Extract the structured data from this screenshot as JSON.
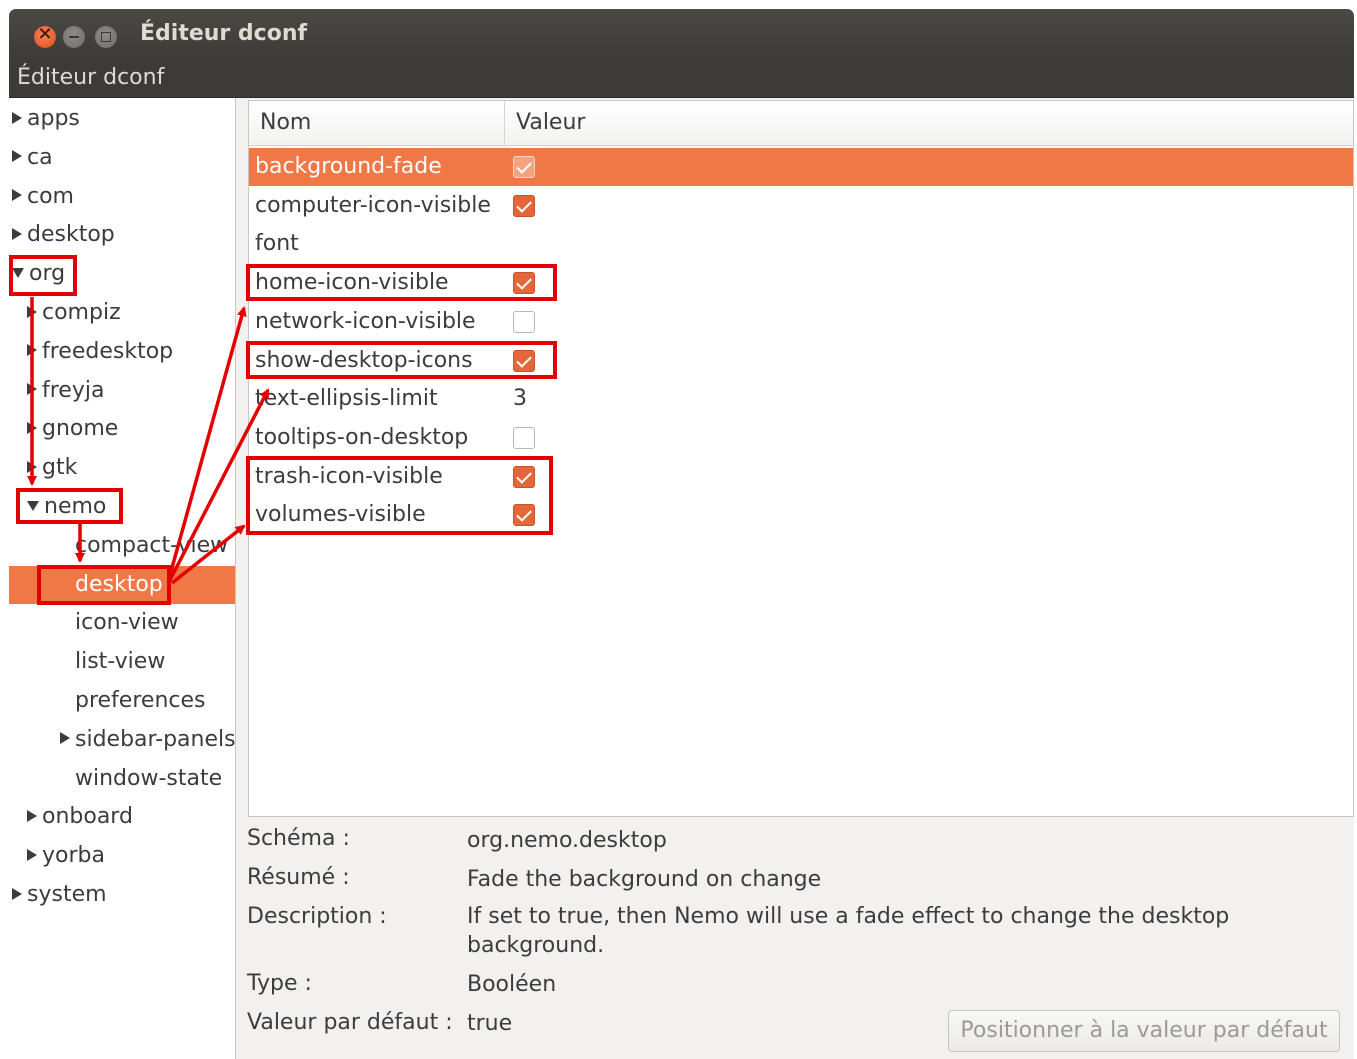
{
  "window": {
    "title": "Éditeur dconf"
  },
  "menubar": {
    "app_menu": "Éditeur dconf"
  },
  "tree": {
    "items": [
      {
        "label": "apps",
        "expander": "collapsed",
        "depth": 0,
        "selected": false
      },
      {
        "label": "ca",
        "expander": "collapsed",
        "depth": 0,
        "selected": false
      },
      {
        "label": "com",
        "expander": "collapsed",
        "depth": 0,
        "selected": false
      },
      {
        "label": "desktop",
        "expander": "collapsed",
        "depth": 0,
        "selected": false
      },
      {
        "label": "org",
        "expander": "expanded",
        "depth": 0,
        "selected": false
      },
      {
        "label": "compiz",
        "expander": "collapsed",
        "depth": 1,
        "selected": false
      },
      {
        "label": "freedesktop",
        "expander": "collapsed",
        "depth": 1,
        "selected": false
      },
      {
        "label": "freyja",
        "expander": "collapsed",
        "depth": 1,
        "selected": false
      },
      {
        "label": "gnome",
        "expander": "collapsed",
        "depth": 1,
        "selected": false
      },
      {
        "label": "gtk",
        "expander": "collapsed",
        "depth": 1,
        "selected": false
      },
      {
        "label": "nemo",
        "expander": "expanded",
        "depth": 1,
        "selected": false
      },
      {
        "label": "compact-view",
        "expander": "none",
        "depth": 2,
        "selected": false
      },
      {
        "label": "desktop",
        "expander": "none",
        "depth": 2,
        "selected": true
      },
      {
        "label": "icon-view",
        "expander": "none",
        "depth": 2,
        "selected": false
      },
      {
        "label": "list-view",
        "expander": "none",
        "depth": 2,
        "selected": false
      },
      {
        "label": "preferences",
        "expander": "none",
        "depth": 2,
        "selected": false
      },
      {
        "label": "sidebar-panels",
        "expander": "collapsed",
        "depth": 2,
        "selected": false
      },
      {
        "label": "window-state",
        "expander": "none",
        "depth": 2,
        "selected": false
      },
      {
        "label": "onboard",
        "expander": "collapsed",
        "depth": 1,
        "selected": false
      },
      {
        "label": "yorba",
        "expander": "collapsed",
        "depth": 1,
        "selected": false
      },
      {
        "label": "system",
        "expander": "collapsed",
        "depth": 0,
        "selected": false
      }
    ]
  },
  "keys": {
    "columns": [
      "Nom",
      "Valeur"
    ],
    "rows": [
      {
        "name": "background-fade",
        "type": "bool",
        "value": true,
        "selected": true
      },
      {
        "name": "computer-icon-visible",
        "type": "bool",
        "value": true,
        "selected": false
      },
      {
        "name": "font",
        "type": "text",
        "value": "",
        "selected": false
      },
      {
        "name": "home-icon-visible",
        "type": "bool",
        "value": true,
        "selected": false
      },
      {
        "name": "network-icon-visible",
        "type": "bool",
        "value": false,
        "selected": false
      },
      {
        "name": "show-desktop-icons",
        "type": "bool",
        "value": true,
        "selected": false
      },
      {
        "name": "text-ellipsis-limit",
        "type": "text",
        "value": "3",
        "selected": false
      },
      {
        "name": "tooltips-on-desktop",
        "type": "bool",
        "value": false,
        "selected": false
      },
      {
        "name": "trash-icon-visible",
        "type": "bool",
        "value": true,
        "selected": false
      },
      {
        "name": "volumes-visible",
        "type": "bool",
        "value": true,
        "selected": false
      }
    ]
  },
  "details": {
    "schema_label": "Schéma :",
    "schema_value": "org.nemo.desktop",
    "summary_label": "Résumé :",
    "summary_value": "Fade the background on change",
    "description_label": "Description :",
    "description_value": "If set to true, then Nemo will use a fade effect to change the desktop background.",
    "type_label": "Type :",
    "type_value": "Booléen",
    "default_label": "Valeur par défaut :",
    "default_value": "true"
  },
  "buttons": {
    "reset_default": "Positionner à la valeur par défaut"
  },
  "colors": {
    "selection": "#f07746",
    "titlebar": "#3c3b37",
    "annotation": "#e20000"
  }
}
